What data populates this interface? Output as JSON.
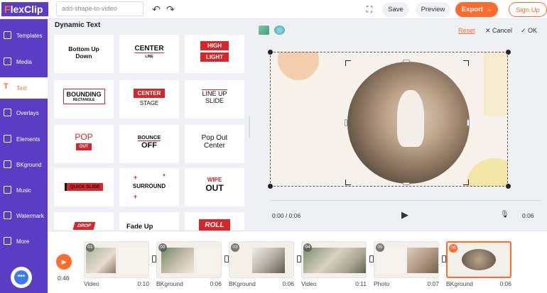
{
  "app": {
    "logo_prefix": "F",
    "logo_text": "lexClip"
  },
  "header": {
    "search_placeholder": "add-shape-to-video",
    "save_label": "Save",
    "preview_label": "Preview",
    "export_label": "Export →",
    "signup_label": "Sign Up",
    "undo_icon": "↶",
    "redo_icon": "↷",
    "fullscreen_icon": "⛶"
  },
  "sidebar": {
    "items": [
      {
        "label": "Templates"
      },
      {
        "label": "Media"
      },
      {
        "label": "Text",
        "active": true,
        "icon_glyph": "T"
      },
      {
        "label": "Overlays"
      },
      {
        "label": "Elements"
      },
      {
        "label": "BKground"
      },
      {
        "label": "Music"
      },
      {
        "label": "Watermark"
      },
      {
        "label": "More"
      }
    ],
    "help_glyph": "•••"
  },
  "panel": {
    "title": "Dynamic Text",
    "tiles": [
      {
        "line1": "Bottom Up",
        "line2": "Down"
      },
      {
        "line1": "CENTER",
        "line2": "LINE"
      },
      {
        "line1": "HIGH",
        "line2": "LIGHT"
      },
      {
        "line1": "BOUNDING",
        "line2": "RECTANGLE"
      },
      {
        "line1": "CENTER",
        "line2": "STAGE"
      },
      {
        "line1": "LINE UP",
        "line2": "SLIDE"
      },
      {
        "line1": "POP",
        "line2": "OUT"
      },
      {
        "line1": "BOUNCE",
        "line2": "OFF"
      },
      {
        "line1": "Pop Out",
        "line2": "Center"
      },
      {
        "line1": "QUICK SLIDE",
        "line2": ""
      },
      {
        "line1": "SURROUND",
        "line2": ""
      },
      {
        "line1": "WIPE",
        "line2": "OUT"
      },
      {
        "line1": "DROP",
        "line2": ""
      },
      {
        "line1": "Fade Up",
        "line2": ""
      },
      {
        "line1": "ROLL",
        "line2": ""
      }
    ],
    "collapse_glyph": "‹"
  },
  "canvas": {
    "reset_label": "Reset",
    "cancel_label": "✕ Cancel",
    "ok_label": "✓ OK",
    "time_display": "0:00 / 0:06",
    "duration": "0:06",
    "play_glyph": "▶",
    "mic_glyph": "🎙"
  },
  "timeline": {
    "current_time": "0:46",
    "play_glyph": "▶",
    "clips": [
      {
        "num": "01",
        "type": "Video",
        "duration": "0:10"
      },
      {
        "num": "02",
        "type": "BKground",
        "duration": "0:06"
      },
      {
        "num": "03",
        "type": "BKground",
        "duration": "0:06"
      },
      {
        "num": "04",
        "type": "Video",
        "duration": "0:11"
      },
      {
        "num": "05",
        "type": "Photo",
        "duration": "0:07"
      },
      {
        "num": "06",
        "type": "BKground",
        "duration": "0:06",
        "selected": true
      }
    ]
  },
  "colors": {
    "brand_purple": "#5b3cc4",
    "accent_orange": "#ff6b2c",
    "text_red": "#d7262b"
  }
}
